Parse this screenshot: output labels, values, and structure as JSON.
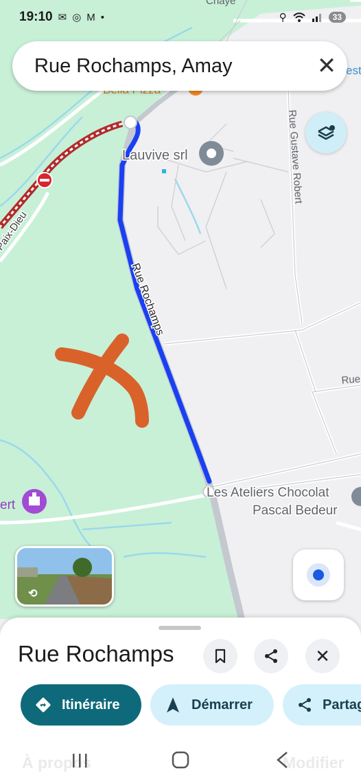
{
  "status_bar": {
    "time": "19:10",
    "left_icons": [
      "mail-icon",
      "hotspot-icon",
      "gmail-icon",
      "dot-icon"
    ],
    "right_icons": [
      "location-icon",
      "wifi-icon",
      "signal-icon"
    ],
    "battery": "33"
  },
  "search": {
    "value": "Rue Rochamps, Amay",
    "close_icon": "close-icon"
  },
  "map": {
    "labels": {
      "poi_lauvive": "Lauvive srl",
      "street_gustave": "Rue Gustave Robert",
      "street_rochamps": "Rue Rochamps",
      "street_paix_dieu": "Paix-Dieu",
      "street_rue_partial": "Rue",
      "poi_chocolat_1": "Les Ateliers Chocolat",
      "poi_chocolat_2": "Pascal Bedeur",
      "poi_pizza_partial": "Bella Pizza",
      "partial_ert": "ert",
      "partial_est": "est",
      "partial_top": "Chaye"
    },
    "route_color": "#1a40f2",
    "annotation_color": "#d9622b"
  },
  "place_sheet": {
    "title": "Rue Rochamps",
    "save_icon": "bookmark-icon",
    "share_icon": "share-icon",
    "close_icon": "close-icon",
    "actions": [
      {
        "label": "Itinéraire",
        "icon": "directions-icon"
      },
      {
        "label": "Démarrer",
        "icon": "navigation-arrow-icon"
      },
      {
        "label": "Partager",
        "icon": "share-icon"
      }
    ],
    "faded_left": "À propos",
    "faded_right": "Modifier"
  },
  "colors": {
    "park_green": "#c8f0d7",
    "urban_gray": "#f0eff2",
    "water_blue": "#9ad9ec",
    "accent_teal": "#0e6a7b"
  }
}
